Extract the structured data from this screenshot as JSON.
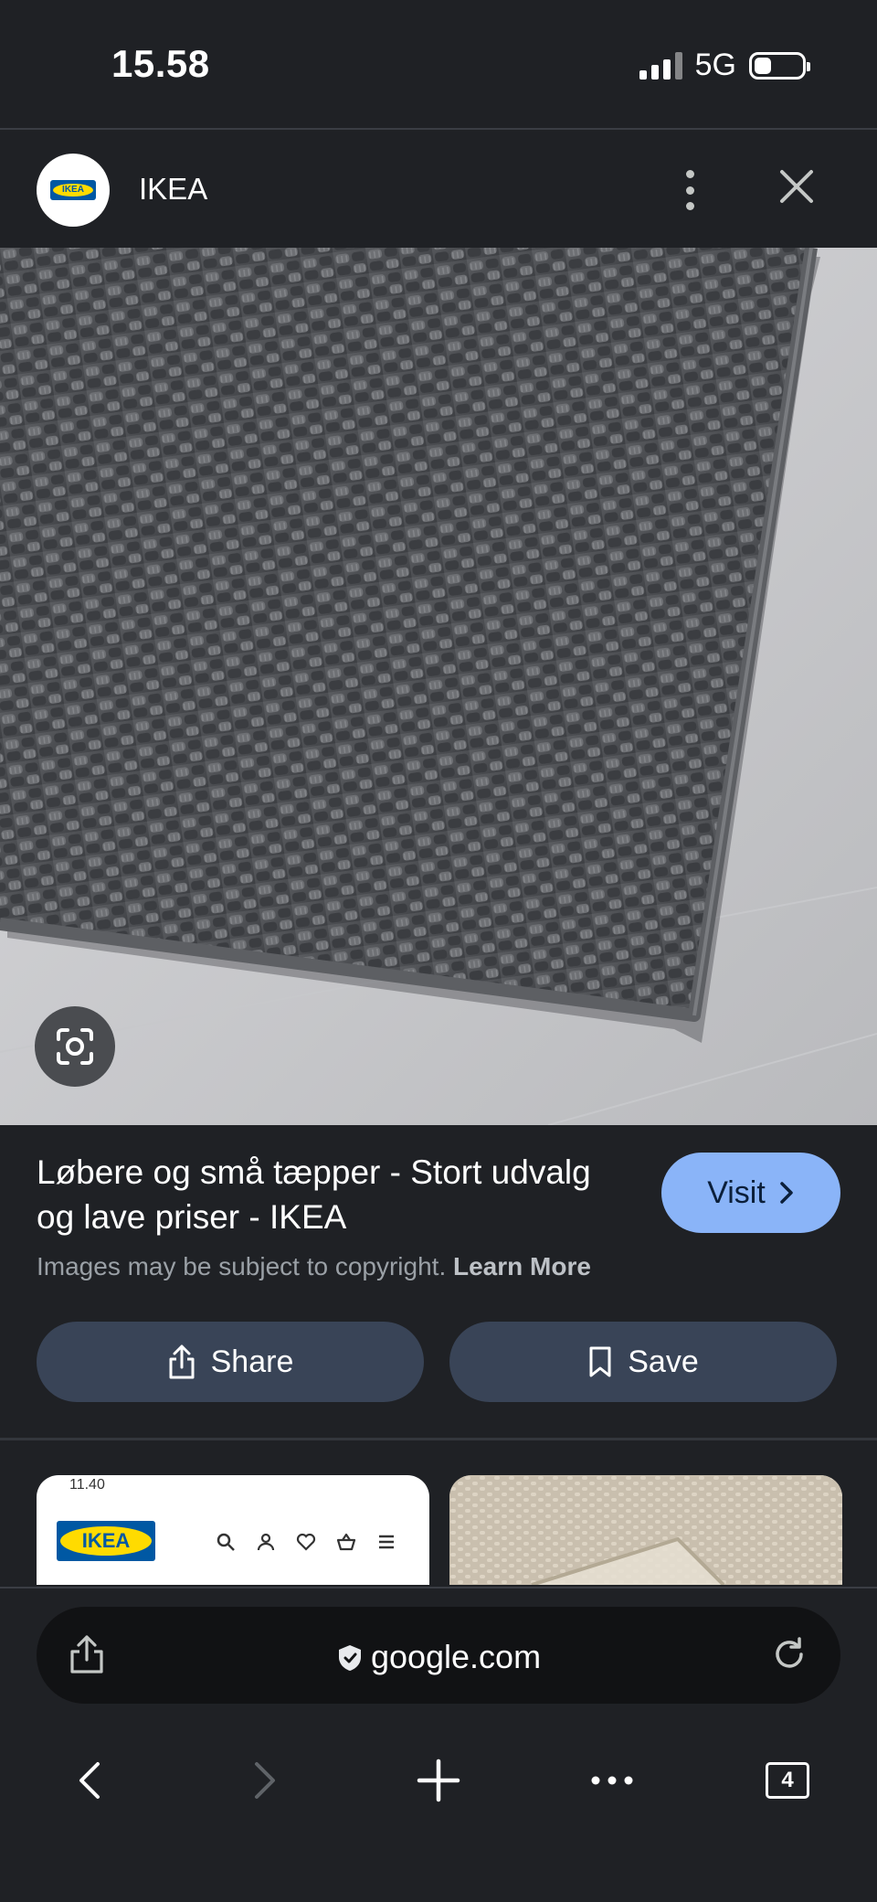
{
  "status": {
    "time": "15.58",
    "network": "5G"
  },
  "site": {
    "name": "IKEA",
    "logo_text": "IKEA"
  },
  "hero": {
    "image": "dark grey woven rug corner on light wooden floor"
  },
  "result": {
    "title": "Løbere og små tæpper - Stort udvalg og lave priser - IKEA",
    "visit_label": "Visit",
    "copyright_text": "Images may be subject to copyright.",
    "learn_more": "Learn More"
  },
  "actions": {
    "share_label": "Share",
    "save_label": "Save"
  },
  "thumbnails": {
    "first_time": "11.40",
    "first_logo": "IKEA"
  },
  "browser": {
    "url": "google.com",
    "tab_count": "4"
  },
  "colors": {
    "background": "#1f2125",
    "visit_button": "#8ab4f8",
    "action_button": "#394457"
  }
}
